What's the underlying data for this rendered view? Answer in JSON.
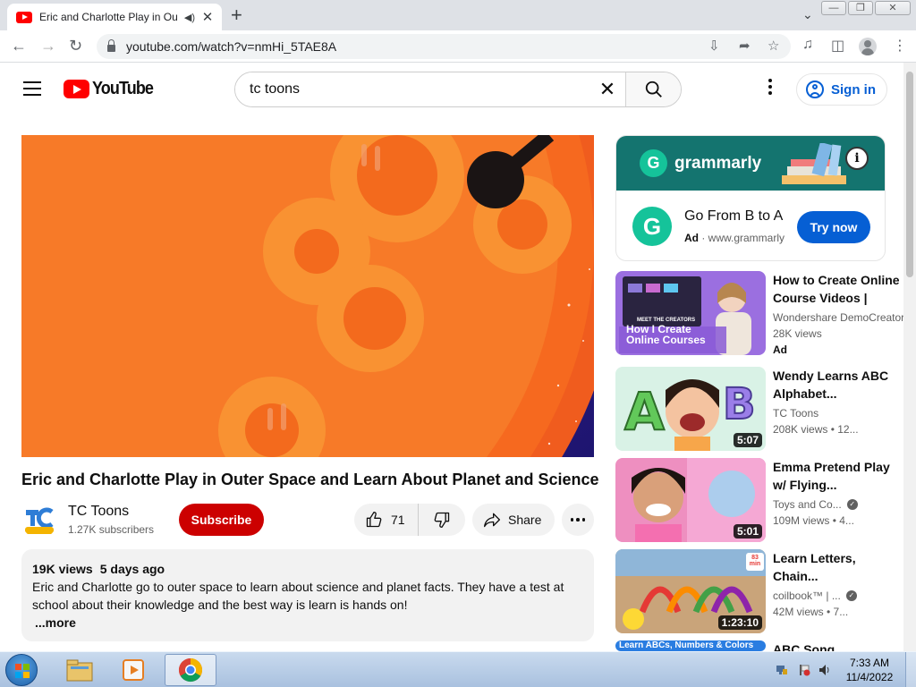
{
  "browser": {
    "tab_title": "Eric and Charlotte Play in Ou",
    "url": "youtube.com/watch?v=nmHi_5TAE8A"
  },
  "youtube": {
    "logo_text": "YouTube",
    "search_value": "tc toons",
    "signin_label": "Sign in"
  },
  "video": {
    "title": "Eric and Charlotte Play in Outer Space and Learn About Planet and Science",
    "channel_name": "TC Toons",
    "subscribers": "1.27K subscribers",
    "subscribe_label": "Subscribe",
    "like_count": "71",
    "share_label": "Share",
    "views": "19K views",
    "age": "5 days ago",
    "description": "Eric and Charlotte go to outer space to learn about science and planet facts. They have a test at school about their knowledge and the best way is learn is hands on!",
    "more_label": "...more"
  },
  "ad": {
    "brand": "grammarly",
    "headline": "Go From B to A",
    "ad_label": "Ad",
    "url": "www.grammarly",
    "cta": "Try now"
  },
  "recommended": [
    {
      "title": "How to Create Online Course Videos | Meet...",
      "channel": "Wondershare DemoCreator",
      "meta": "28K views",
      "badge": "Ad",
      "thumb_caption_small": "MEET THE CREATORS",
      "thumb_caption": "How I Create Online Courses"
    },
    {
      "title": "Wendy Learns ABC Alphabet...",
      "channel": "TC Toons",
      "meta": "208K views  • 12...",
      "duration": "5:07"
    },
    {
      "title": "Emma Pretend Play w/ Flying...",
      "channel": "Toys and Co...",
      "meta": "109M views  • 4...",
      "duration": "5:01"
    },
    {
      "title": "Learn Letters, Chain...",
      "channel": "coilbook™ | ...",
      "meta": "42M views  • 7...",
      "duration": "1:23:10",
      "thumb_badge": "83 min"
    },
    {
      "title": "ABC Song",
      "thumb_caption": "Learn ABCs, Numbers & Colors"
    }
  ],
  "taskbar": {
    "time": "7:33 AM",
    "date": "11/4/2022"
  }
}
